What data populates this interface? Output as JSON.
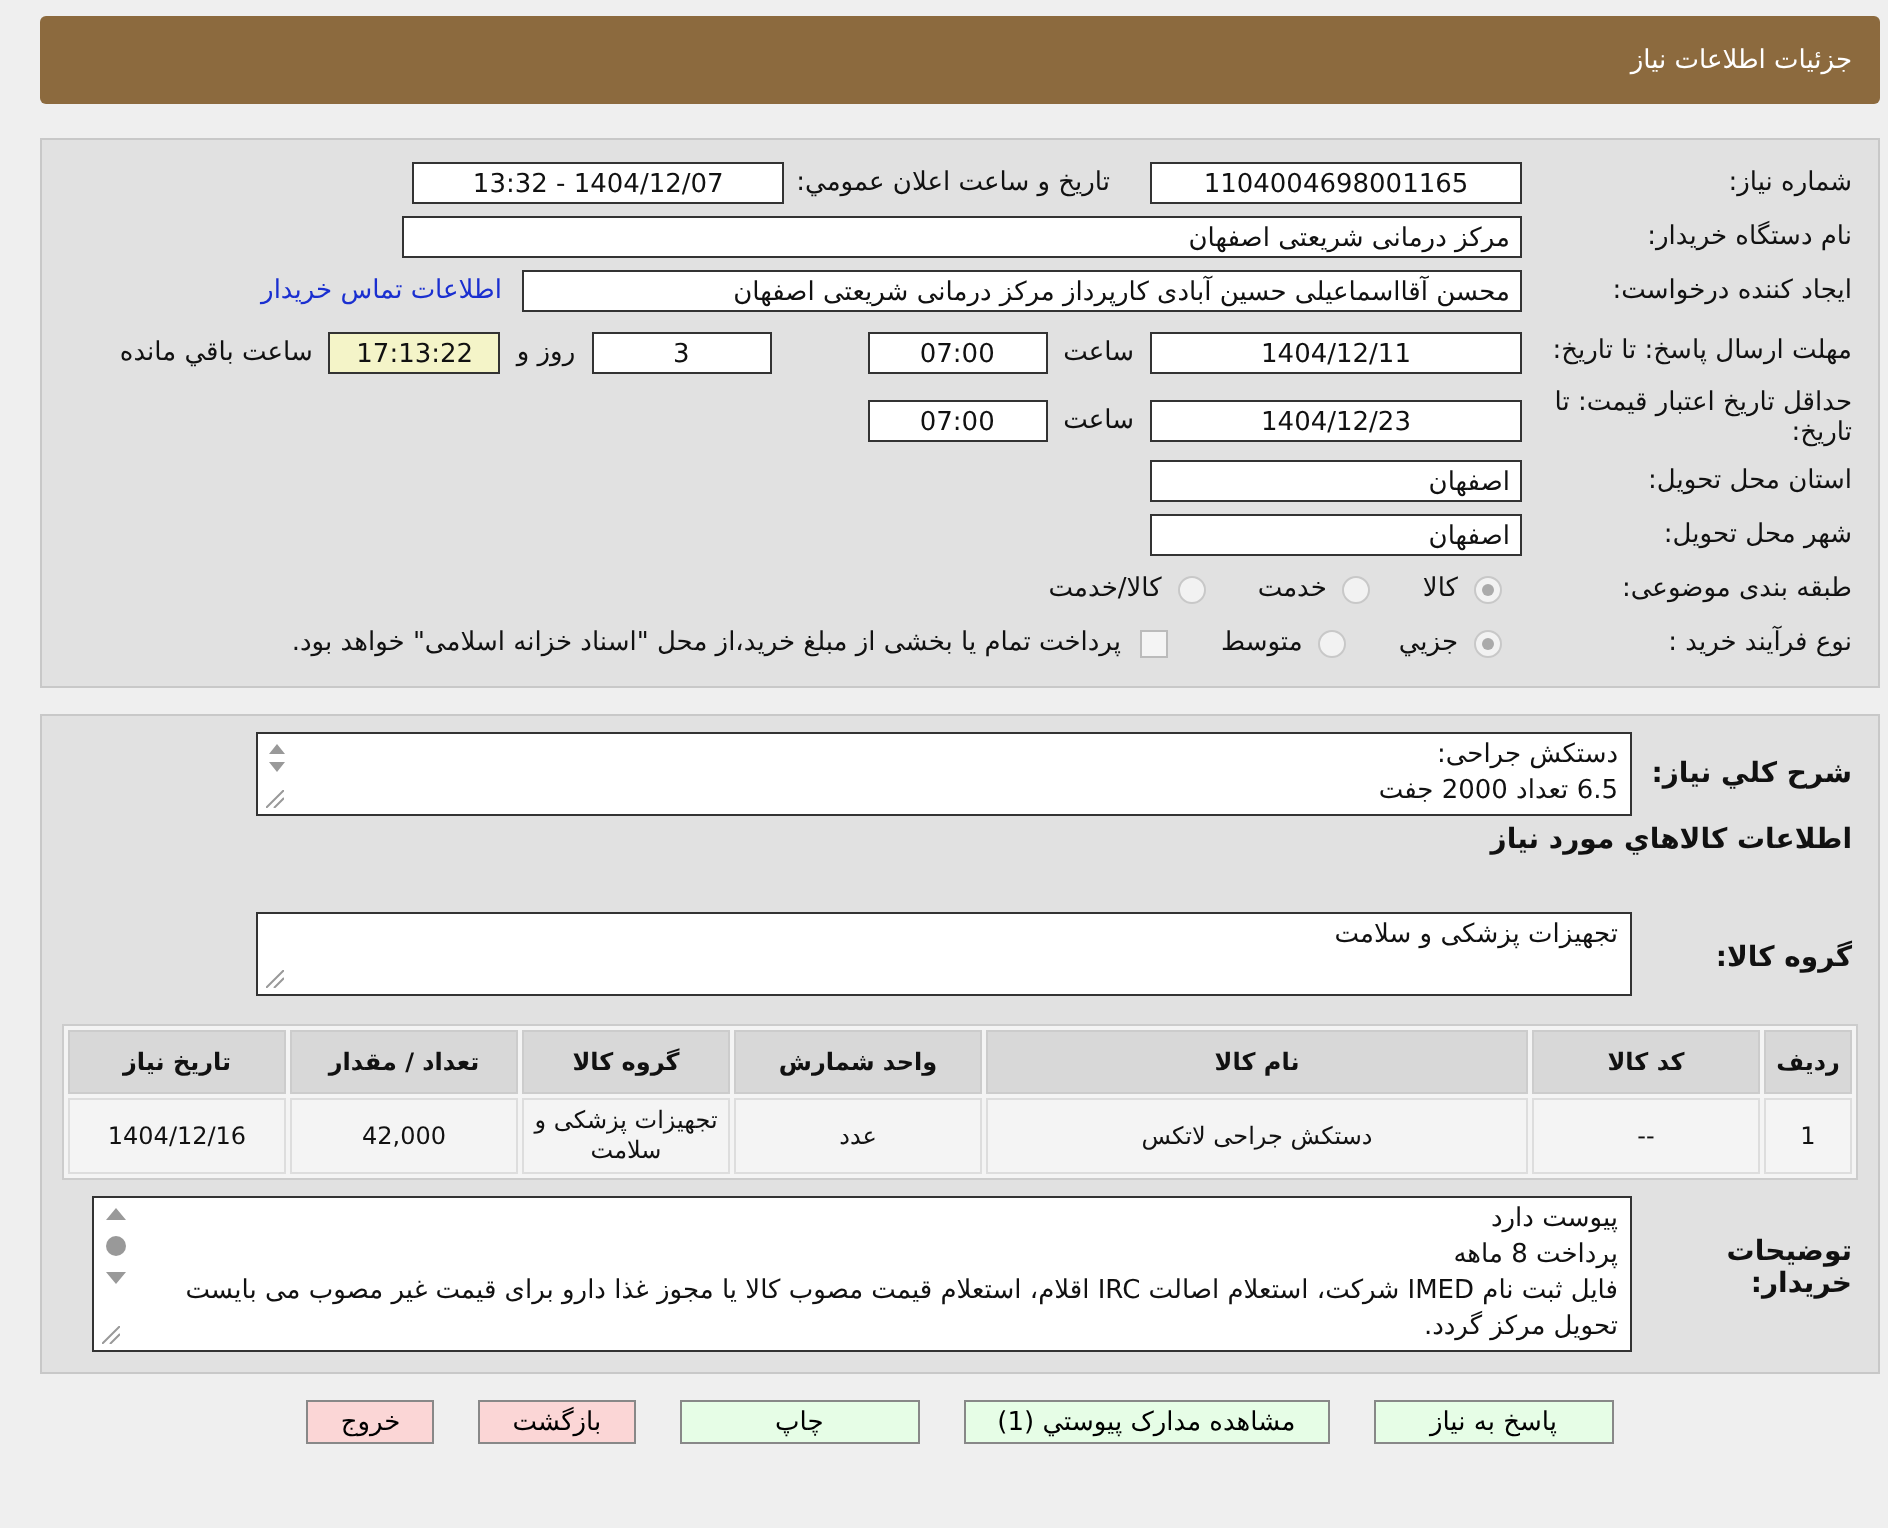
{
  "header": {
    "title": "جزئیات اطلاعات نیاز"
  },
  "need_number": {
    "label": "شماره نیاز:",
    "value": "1104004698001165"
  },
  "announce": {
    "label": "تاریخ و ساعت اعلان عمومي:",
    "value": "1404/12/07 - 13:32"
  },
  "buyer_org": {
    "label": "نام دستگاه خریدار:",
    "value": "مرکز درمانی شریعتی اصفهان"
  },
  "requester": {
    "label": "ایجاد کننده درخواست:",
    "value": "محسن آقااسماعیلی حسین آبادی کارپرداز مرکز درمانی شریعتی اصفهان",
    "link": "اطلاعات تماس خریدار"
  },
  "deadline": {
    "label": "مهلت ارسال پاسخ: تا تاریخ:",
    "date": "1404/12/11",
    "time_label": "ساعت",
    "time": "07:00",
    "days": "3",
    "days_label": "روز و",
    "remaining": "17:13:22",
    "remaining_label": "ساعت باقي مانده"
  },
  "validity": {
    "label": "حداقل تاریخ اعتبار قیمت: تا تاریخ:",
    "date": "1404/12/23",
    "time_label": "ساعت",
    "time": "07:00"
  },
  "province": {
    "label": "استان محل تحویل:",
    "value": "اصفهان"
  },
  "city": {
    "label": "شهر محل تحویل:",
    "value": "اصفهان"
  },
  "category": {
    "label": "طبقه بندی موضوعی:",
    "options": [
      {
        "label": "کالا",
        "selected": true
      },
      {
        "label": "خدمت",
        "selected": false
      },
      {
        "label": "کالا/خدمت",
        "selected": false
      }
    ]
  },
  "purchase_type": {
    "label": "نوع فرآیند خرید :",
    "options": [
      {
        "label": "جزيي",
        "selected": true
      },
      {
        "label": "متوسط",
        "selected": false
      }
    ],
    "payment_note": {
      "checked": false,
      "text": "پرداخت تمام یا بخشی از مبلغ خرید،از محل \"اسناد خزانه اسلامی\" خواهد بود."
    }
  },
  "description": {
    "label": "شرح کلي نیاز:",
    "lines": [
      "دستکش جراحی:",
      "6.5 تعداد 2000 جفت"
    ]
  },
  "goods_title": "اطلاعات کالاهاي مورد نیاز",
  "goods_group": {
    "label": "گروه کالا:",
    "value": "تجهیزات پزشکی و سلامت"
  },
  "table": {
    "columns": [
      "ردیف",
      "کد کالا",
      "نام کالا",
      "واحد شمارش",
      "گروه کالا",
      "تعداد / مقدار",
      "تاریخ نیاز"
    ],
    "rows": [
      [
        "1",
        "--",
        "دستکش جراحی لاتکس",
        "عدد",
        "تجهیزات پزشکی و سلامت",
        "42,000",
        "1404/12/16"
      ]
    ]
  },
  "buyer_notes": {
    "label": "توضیحات خریدار:",
    "lines": [
      "پیوست دارد",
      "پرداخت 8 ماهه",
      "فایل ثبت نام IMED شرکت، استعلام اصالت IRC اقلام، استعلام قیمت مصوب کالا یا مجوز غذا دارو برای قیمت غیر مصوب می بایست تحویل مرکز گردد."
    ]
  },
  "buttons": [
    {
      "label": "پاسخ به نیاز",
      "kind": "normal"
    },
    {
      "label": "مشاهده مدارک پیوستي (1)",
      "kind": "normal"
    },
    {
      "label": "چاپ",
      "kind": "normal"
    },
    {
      "label": "بازگشت",
      "kind": "danger"
    },
    {
      "label": "خروج",
      "kind": "danger"
    }
  ]
}
